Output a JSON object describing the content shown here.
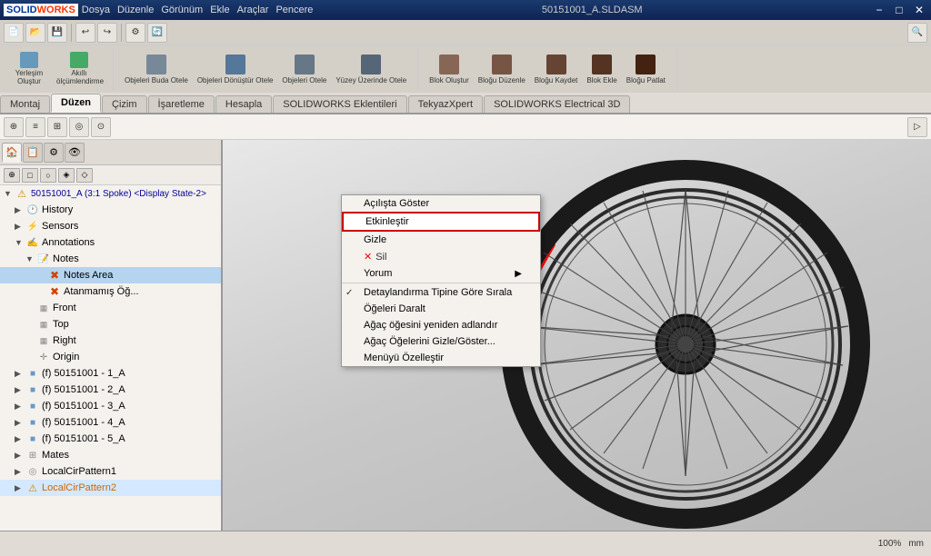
{
  "titlebar": {
    "logo": "SOLIDWORKS",
    "menus": [
      "Dosya",
      "Düzenle",
      "Görünüm",
      "Ekle",
      "Araçlar",
      "Pencere"
    ],
    "title": "50151001_A.SLDASM",
    "controls": [
      "−",
      "□",
      "✕"
    ]
  },
  "tabs": {
    "items": [
      "Montaj",
      "Düzen",
      "Çizim",
      "İşaretleme",
      "Hesapla",
      "SOLIDWORKS Eklentileri",
      "TekyazXpert",
      "SOLIDWORKS Electrical 3D"
    ],
    "active": "Düzen"
  },
  "toolbar": {
    "yerlesim_label": "Yerleşim Oluştur",
    "akilli_label": "Akıllı ölçümlendirme"
  },
  "feature_tree": {
    "root_label": "50151001_A (3:1 Spoke) <Display State-2>",
    "items": [
      {
        "id": "history",
        "label": "History",
        "indent": 1,
        "expanded": false
      },
      {
        "id": "sensors",
        "label": "Sensors",
        "indent": 1,
        "expanded": false
      },
      {
        "id": "annotations",
        "label": "Annotations",
        "indent": 1,
        "expanded": true
      },
      {
        "id": "notes",
        "label": "Notes",
        "indent": 2,
        "expanded": true
      },
      {
        "id": "notes-area",
        "label": "Notes Area",
        "indent": 3,
        "selected": true
      },
      {
        "id": "atanmamis",
        "label": "Atanmamış Öğ...",
        "indent": 3
      },
      {
        "id": "front",
        "label": "Front",
        "indent": 2
      },
      {
        "id": "top",
        "label": "Top",
        "indent": 2
      },
      {
        "id": "right",
        "label": "Right",
        "indent": 2
      },
      {
        "id": "origin",
        "label": "Origin",
        "indent": 2
      },
      {
        "id": "part1",
        "label": "(f) 50151001 - 1_A",
        "indent": 1
      },
      {
        "id": "part2",
        "label": "(f) 50151001 - 2_A",
        "indent": 1
      },
      {
        "id": "part3",
        "label": "(f) 50151001 - 3_A",
        "indent": 1
      },
      {
        "id": "part4",
        "label": "(f) 50151001 - 4_A",
        "indent": 1
      },
      {
        "id": "part5",
        "label": "(f) 50151001 - 5_A",
        "indent": 1
      },
      {
        "id": "mates",
        "label": "Mates",
        "indent": 1
      },
      {
        "id": "pattern1",
        "label": "LocalCirPattern1",
        "indent": 1
      },
      {
        "id": "pattern2",
        "label": "LocalCirPattern2",
        "indent": 1,
        "orange": true
      }
    ]
  },
  "context_menu": {
    "items": [
      {
        "id": "aclista-goster",
        "label": "Açılışta Göster",
        "type": "normal"
      },
      {
        "id": "etkinlestir",
        "label": "Etkinleştir",
        "type": "highlighted"
      },
      {
        "id": "gizle",
        "label": "Gizle",
        "type": "normal"
      },
      {
        "id": "sil",
        "label": "Sil",
        "type": "delete"
      },
      {
        "id": "yorum",
        "label": "Yorum",
        "type": "submenu"
      },
      {
        "id": "separator1",
        "type": "separator"
      },
      {
        "id": "detaylandir",
        "label": "Detaylandırma Tipine Göre Sırala",
        "type": "checked"
      },
      {
        "id": "ogeleri-daralt",
        "label": "Öğeleri Daralt",
        "type": "normal"
      },
      {
        "id": "agac-adlandir",
        "label": "Ağaç öğesini yeniden adlandır",
        "type": "normal"
      },
      {
        "id": "agac-gizle",
        "label": "Ağaç Öğelerini Gizle/Göster...",
        "type": "normal"
      },
      {
        "id": "menu-ozellestir",
        "label": "Menüyü Özelleştir",
        "type": "normal"
      }
    ]
  },
  "statusbar": {
    "text": ""
  }
}
